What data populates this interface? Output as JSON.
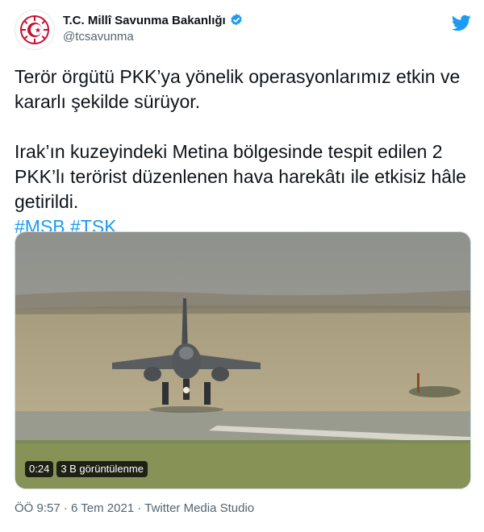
{
  "author": {
    "display_name": "T.C. Millî Savunma Bakanlığı",
    "handle": "@tcsavunma",
    "verified": true
  },
  "tweet": {
    "paragraph1": "Terör örgütü PKK’ya yönelik operasyonlarımız etkin ve kararlı şekilde sürüyor.",
    "paragraph2": "Irak’ın kuzeyindeki Metina bölgesinde tespit edilen 2 PKK’lı terörist düzenlenen hava harekâtı ile etkisiz hâle getirildi.",
    "hashtags": [
      "#MSB",
      "#TSK"
    ]
  },
  "media": {
    "duration": "0:24",
    "views": "3 B görüntülenme"
  },
  "meta": {
    "time": "ÖÖ 9:57",
    "separator": "·",
    "date": "6 Tem 2021",
    "source": "Twitter Media Studio"
  },
  "colors": {
    "link": "#1d9bf0",
    "secondary_text": "#536471",
    "logo_red": "#c8102e"
  },
  "icons": {
    "avatar": "ministry-emblem-icon",
    "verified": "verified-badge-icon",
    "brand": "twitter-bird-icon"
  }
}
